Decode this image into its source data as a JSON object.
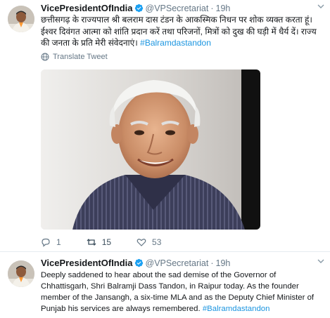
{
  "tweets": [
    {
      "display_name": "VicePresidentOfIndia",
      "handle": "@VPSecretariat",
      "separator": "·",
      "time": "19h",
      "text": "छत्तीसगढ़ के राज्यपाल श्री बलराम दास टंडन के आकस्मिक निधन पर शोक व्यक्त करता हूं। ईश्वर दिवंगत आत्मा को शांति प्रदान करें तथा परिजनों, मित्रों को दुख की घड़ी में धैर्य दें। राज्य की जनता के प्रति मेरी संवेदनाएं।",
      "hashtag": "#Balramdastandon",
      "translate_label": "Translate Tweet",
      "counts": {
        "replies": "1",
        "retweets": "15",
        "likes": "53"
      }
    },
    {
      "display_name": "VicePresidentOfIndia",
      "handle": "@VPSecretariat",
      "separator": "·",
      "time": "19h",
      "text": "Deeply saddened to hear about the sad demise of the Governor of Chhattisgarh, Shri Balramji Dass Tandon, in Raipur today. As the founder member of the Jansangh, a six-time MLA and as the Deputy Chief Minister of Punjab his services are always remembered.",
      "hashtag": "#Balramdastandon"
    }
  ],
  "colors": {
    "link": "#1b95e0",
    "verified": "#1da1f2",
    "meta": "#657786",
    "divider": "#e6ecf0"
  },
  "icons": {
    "verified": "verified-badge-icon",
    "caret": "chevron-down-icon",
    "translate": "globe-icon",
    "reply": "reply-icon",
    "retweet": "retweet-icon",
    "like": "heart-icon"
  }
}
